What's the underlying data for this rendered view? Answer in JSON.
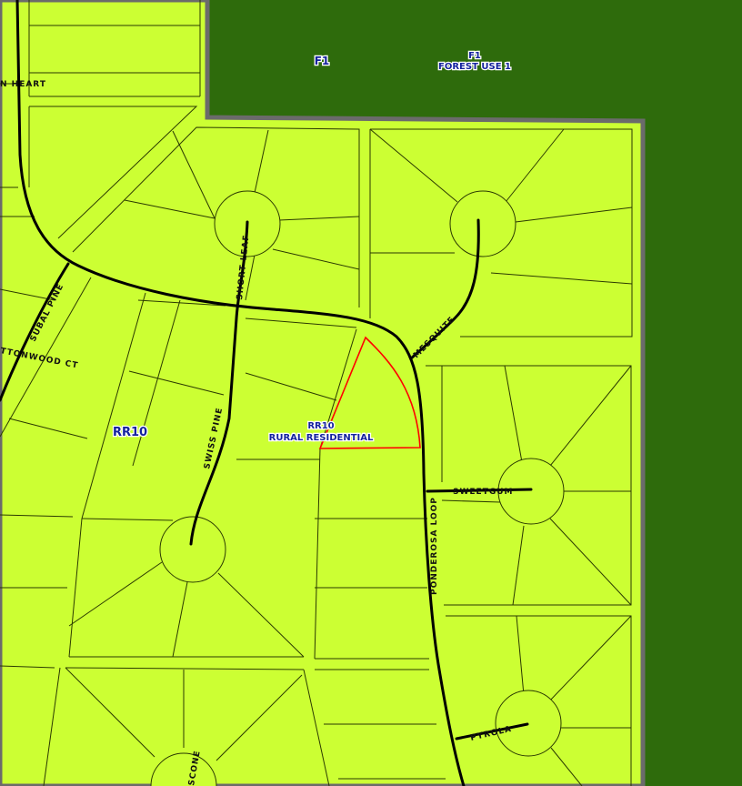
{
  "map": {
    "colors": {
      "forest": "#2e6b0c",
      "residential": "#ccff33",
      "boundary": "#6b6b6b",
      "highlight": "#ff0000",
      "zone_label": "#14229e"
    },
    "zones": {
      "forest_code": "F1",
      "forest_code_2": "F1",
      "forest_name": "FOREST USE 1",
      "residential_code": "RR10",
      "residential_code_2": "RR10",
      "residential_name": "RURAL RESIDENTIAL"
    },
    "streets": {
      "n_heart": "N HEART",
      "subal_pine": "SUBAL PINE",
      "cottonwood_ct": "TTONWOOD CT",
      "short_leaf": "SHORT LEAF",
      "swiss_pine": "SWISS PINE",
      "mesquite": "MESQUITE",
      "sweetgum": "SWEETGUM",
      "ponderosa_loop": "PONDEROSA LOOP",
      "pyrola": "PYROLA",
      "scone": "SCONE"
    }
  }
}
